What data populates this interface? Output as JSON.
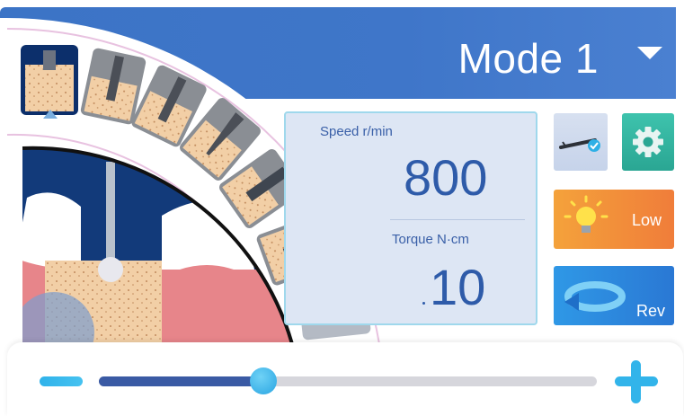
{
  "header": {
    "mode_label": "Mode 1",
    "dropdown_icon": "caret-down-icon"
  },
  "tools": [
    {
      "name": "round-bur"
    },
    {
      "name": "pilot-drill"
    },
    {
      "name": "twist-drill"
    },
    {
      "name": "tapered-drill"
    },
    {
      "name": "thread-tap"
    },
    {
      "name": "implant-screw"
    },
    {
      "name": "handpiece-tools"
    }
  ],
  "panel": {
    "speed_label": "Speed r/min",
    "speed_value": "800",
    "torque_label": "Torque N·cm",
    "torque_value": "10"
  },
  "buttons": {
    "handpiece_icon": "handpiece-icon",
    "settings_icon": "gear-icon",
    "light_label": "Low",
    "light_icon": "bulb-icon",
    "reverse_label": "Rev",
    "reverse_icon": "rotate-arrow-icon"
  },
  "slider": {
    "value_fraction": 0.33,
    "minus_icon": "minus-icon",
    "plus_icon": "plus-icon"
  },
  "colors": {
    "header": "#3c74c6",
    "accent": "#2aa5e2",
    "value_text": "#2e5ba9",
    "settings": "#2aa693",
    "light": "#f07d3a",
    "rev": "#2a78d4"
  }
}
